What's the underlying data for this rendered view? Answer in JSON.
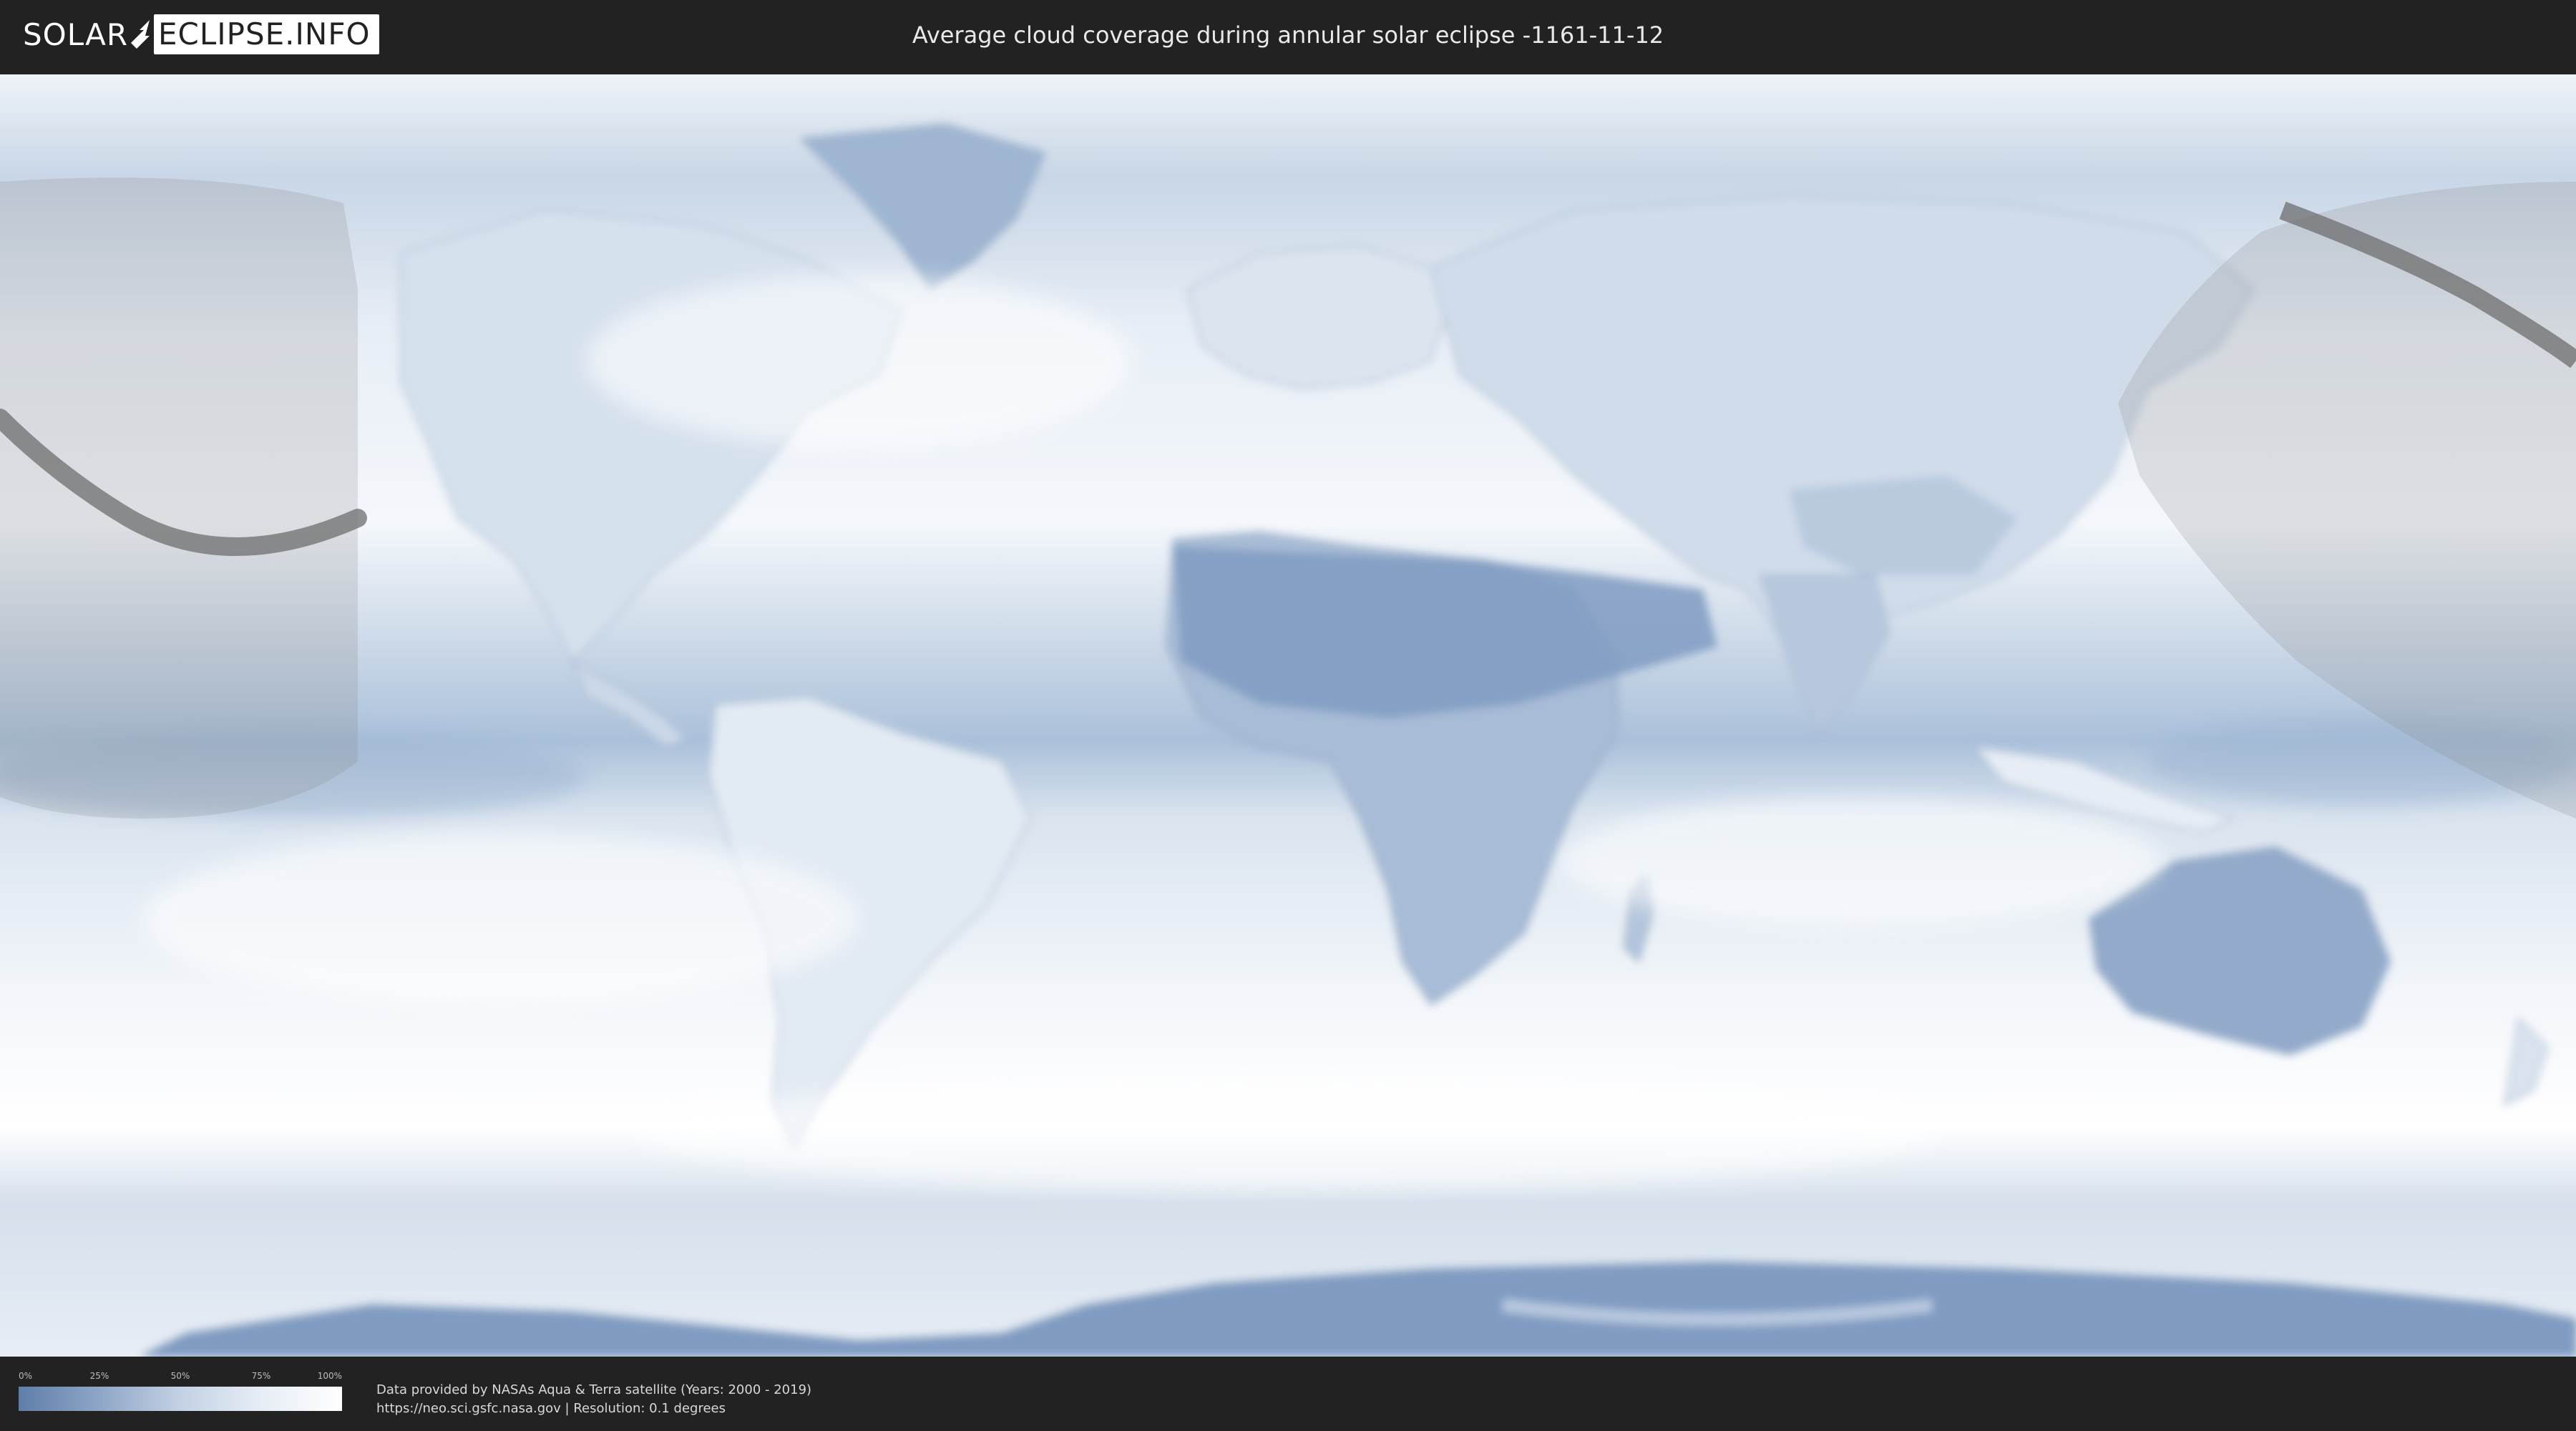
{
  "header": {
    "logo_left": "SOLAR",
    "logo_right": "ECLIPSE.INFO",
    "title": "Average cloud coverage during annular solar eclipse -1161-11-12"
  },
  "map": {
    "type": "world cloud coverage map",
    "projection": "equirectangular",
    "colors": {
      "low_coverage": "#5f7ea9",
      "high_coverage": "#ffffff",
      "eclipse_shadow": "#9a9a9a",
      "eclipse_path": "#6e6e6e"
    }
  },
  "legend": {
    "ticks": [
      "0%",
      "25%",
      "50%",
      "75%",
      "100%"
    ]
  },
  "source": {
    "line1": "Data provided by NASAs Aqua & Terra satellite (Years: 2000 - 2019)",
    "line2": "https://neo.sci.gsfc.nasa.gov | Resolution: 0.1 degrees"
  }
}
